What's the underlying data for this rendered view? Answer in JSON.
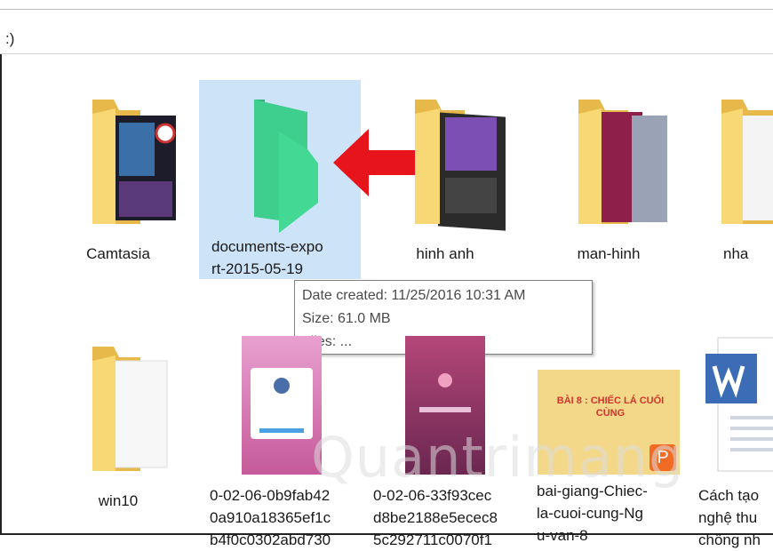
{
  "breadcrumb_tail": ":)",
  "row1": [
    {
      "name": "Camtasia"
    },
    {
      "name_line1": "documents-expo",
      "name_line2": "rt-2015-05-19"
    },
    {
      "name": "hinh anh"
    },
    {
      "name": "man-hinh"
    },
    {
      "name": "nha"
    }
  ],
  "row2": [
    {
      "name": "win10"
    },
    {
      "line1": "0-02-06-0b9fab42",
      "line2": "0a910a18365ef1c",
      "line3": "b4f0c0302abd730"
    },
    {
      "line1": "0-02-06-33f93cec",
      "line2": "d8be2188e5ecec8",
      "line3": "5c292711c0070f1"
    },
    {
      "line1": "bai-giang-Chiec-",
      "line2": "la-cuoi-cung-Ng",
      "line3": "u-van-8"
    },
    {
      "line1": "Cách tạo",
      "line2": "nghệ thu",
      "line3": "chồng nh"
    }
  ],
  "tooltip": {
    "date": "Date created: 11/25/2016 10:31 AM",
    "size": "Size: 61.0 MB",
    "files": "Files: ..."
  },
  "ppt_thumb_text": "BÀI 8 : CHIẾC LÁ CUỐI CÙNG",
  "watermark": "Quantrimang",
  "colors": {
    "selection": "#cde3f7",
    "folder_yellow": "#f8d775",
    "green_folder": "#3ecf8e",
    "arrow_red": "#e8141b"
  }
}
